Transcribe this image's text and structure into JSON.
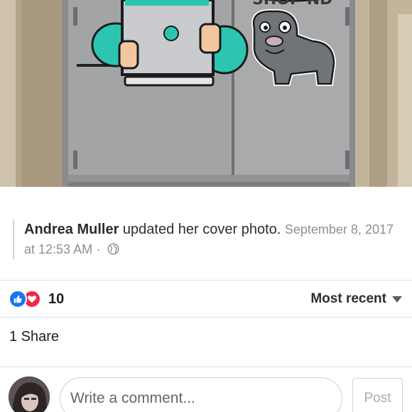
{
  "cover_photo": {
    "icon": "painted-door-image",
    "graffiti_text": "SHOP ND"
  },
  "post": {
    "author": "Andrea Muller",
    "action": "updated her cover photo.",
    "timestamp": "September 8, 2017 at 12:53 AM",
    "separator": "·",
    "privacy_icon": "globe-icon"
  },
  "reactions": {
    "icons": [
      "like-icon",
      "love-icon"
    ],
    "count": "10",
    "colors": {
      "like": "#1877f2",
      "love": "#f0284a"
    }
  },
  "sort": {
    "label": "Most recent",
    "icon": "caret-down-icon"
  },
  "shares": {
    "label": "1 Share"
  },
  "composer": {
    "placeholder": "Write a comment...",
    "post_label": "Post",
    "avatar_icon": "user-avatar"
  }
}
